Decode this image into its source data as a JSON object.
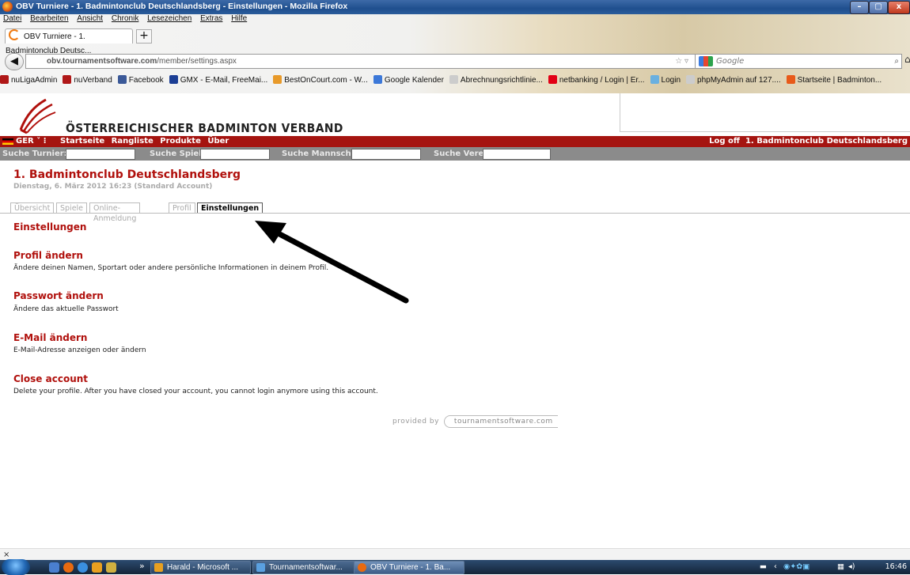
{
  "window": {
    "title": "OBV Turniere - 1. Badmintonclub Deutschlandsberg - Einstellungen - Mozilla Firefox",
    "min": "–",
    "max": "▢",
    "close": "x"
  },
  "menu": [
    "Datei",
    "Bearbeiten",
    "Ansicht",
    "Chronik",
    "Lesezeichen",
    "Extras",
    "Hilfe"
  ],
  "browser_tab": {
    "label": "OBV Turniere - 1. Badmintonclub Deutsc...",
    "new_tab": "+"
  },
  "url": {
    "host": "obv.tournamentsoftware.com",
    "path": "/member/settings.aspx"
  },
  "search": {
    "placeholder": "Google"
  },
  "bookmarks": [
    {
      "label": "nuLigaAdmin",
      "color": "#b01818"
    },
    {
      "label": "nuVerband",
      "color": "#b01818"
    },
    {
      "label": "Facebook",
      "color": "#3b5998"
    },
    {
      "label": "GMX - E-Mail, FreeMai...",
      "color": "#1c3f95"
    },
    {
      "label": "BestOnCourt.com - W...",
      "color": "#e89a2a"
    },
    {
      "label": "Google Kalender",
      "color": "#3c78d8"
    },
    {
      "label": "Abrechnungsrichtlinie...",
      "color": "#cccccc"
    },
    {
      "label": "netbanking / Login | Er...",
      "color": "#e20015"
    },
    {
      "label": "Login",
      "color": "#6ab0e0"
    },
    {
      "label": "phpMyAdmin auf 127....",
      "color": "#cccccc"
    },
    {
      "label": "Startseite | Badminton...",
      "color": "#e85a1a"
    }
  ],
  "header": {
    "org_name": "ÖSTERREICHISCHER BADMINTON VERBAND"
  },
  "nav": {
    "lang": "GER",
    "items": [
      "Startseite",
      "Rangliste",
      "Produkte",
      "Über"
    ],
    "logoff": "Log off",
    "user": "1. Badmintonclub Deutschlandsberg"
  },
  "search_row": {
    "turnier": "Suche Turnier:",
    "spieler": "Suche Spieler:",
    "mannschaft": "Suche Mannschaft:",
    "verein": "Suche Verein:"
  },
  "page": {
    "club_name": "1. Badmintonclub Deutschlandsberg",
    "date_line": "Dienstag, 6. März 2012 16:23 (Standard Account)",
    "tabs": [
      "Übersicht",
      "Spiele",
      "Online-Anmeldung",
      "Profil",
      "Einstellungen"
    ],
    "heading": "Einstellungen",
    "sections": [
      {
        "title": "Profil ändern",
        "desc": "Ändere deinen Namen, Sportart oder andere persönliche Informationen in deinem Profil."
      },
      {
        "title": "Passwort ändern",
        "desc": "Ändere das aktuelle Passwort"
      },
      {
        "title": "E-Mail ändern",
        "desc": "E-Mail-Adresse anzeigen oder ändern"
      },
      {
        "title": "Close account",
        "desc": "Delete your profile. After you have closed your account, you cannot login anymore using this account."
      }
    ],
    "provided_by": "provided by",
    "provider": "tournamentsoftware.com"
  },
  "statusbar": {
    "close": "×"
  },
  "taskbar": {
    "more": "»",
    "tasks": [
      {
        "label": "Harald - Microsoft ...",
        "color": "#e8a020"
      },
      {
        "label": "Tournamentsoftwar...",
        "color": "#5aa0e0"
      },
      {
        "label": "OBV Turniere - 1. Ba...",
        "color": "#e86a10"
      }
    ],
    "clock": "16:46"
  }
}
